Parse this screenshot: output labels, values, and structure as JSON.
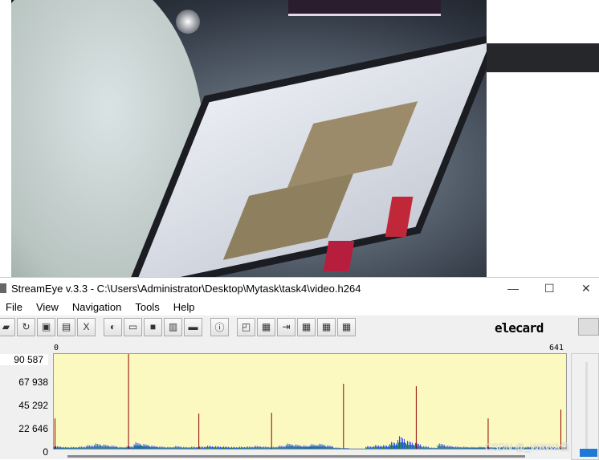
{
  "window": {
    "title": "StreamEye v.3.3 - C:\\Users\\Administrator\\Desktop\\Mytask\\task4\\video.h264",
    "minimize": "—",
    "maximize": "☐",
    "close": "✕"
  },
  "menu": [
    "File",
    "View",
    "Navigation",
    "Tools",
    "Help"
  ],
  "toolbar": [
    "open-icon",
    "reload-icon",
    "save-icon",
    "copy-icon",
    "close-file-icon",
    "filter-icon",
    "line-view-icon",
    "block-view-icon",
    "chart-icon",
    "folder-icon",
    "info-icon",
    "macroblock-icon",
    "grid-icon",
    "motion-vector-icon",
    "grid-2-icon",
    "grid-3-icon",
    "grid-4-icon"
  ],
  "toolbar_glyphs": [
    "▰",
    "↻",
    "▣",
    "▤",
    "X",
    "◐",
    "▭",
    "■",
    "▥",
    "▬",
    "ⓘ",
    "◰",
    "▦",
    "⇥",
    "▦",
    "▦",
    "▦"
  ],
  "logo": "elecard",
  "watermark": "CSDN @_WAWA鱼",
  "chart_data": {
    "type": "bar",
    "xlim": [
      0,
      641
    ],
    "ylim": [
      0,
      90587
    ],
    "x_tick_labels": [
      "0",
      "641"
    ],
    "y_tick_labels": [
      "90 587",
      "67 938",
      "45 292",
      "22 646",
      "0"
    ],
    "colors": {
      "I": "#8b0000",
      "P": "#1f3fff",
      "B": "#1f9a3a",
      "background": "#fcf9c0"
    },
    "i_frames": [
      {
        "frame": 1,
        "size": 29000
      },
      {
        "frame": 93,
        "size": 90587
      },
      {
        "frame": 181,
        "size": 33600
      },
      {
        "frame": 272,
        "size": 34400
      },
      {
        "frame": 362,
        "size": 62100
      },
      {
        "frame": 453,
        "size": 59800
      },
      {
        "frame": 543,
        "size": 29000
      },
      {
        "frame": 634,
        "size": 37500
      }
    ],
    "p_frame_sizes_every_10": [
      2500,
      1800,
      1800,
      2200,
      3500,
      5000,
      4000,
      3000,
      1800,
      2500,
      6000,
      4500,
      3000,
      2200,
      1800,
      2600,
      1800,
      2000,
      2200,
      3000,
      2500,
      2200,
      1800,
      2000,
      2200,
      2800,
      2200,
      2000,
      3000,
      5000,
      4000,
      3200,
      4500,
      4800,
      3200,
      1200,
      800,
      300,
      300,
      2500,
      3500,
      3500,
      6500,
      12000,
      7500,
      5500,
      2500,
      1200,
      5000,
      3000,
      2200,
      2000,
      1800,
      2000,
      1800,
      1800,
      2200,
      2000,
      1800,
      2000,
      2200,
      2400,
      1800,
      1800,
      1800
    ]
  }
}
